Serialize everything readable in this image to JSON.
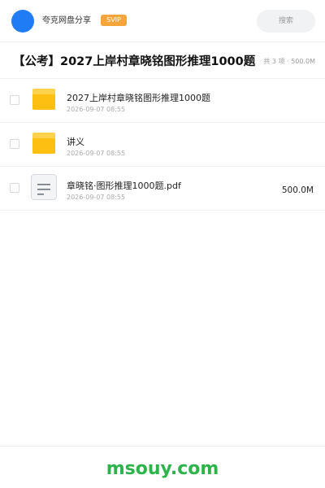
{
  "header": {
    "app_name": "夸克网盘分享",
    "badge": "SVIP",
    "search_placeholder": "搜索",
    "avatar_color": "#1f7cf5",
    "badge_color": "#f6a53a"
  },
  "folder": {
    "title": "【公考】2027上岸村章晓铭图形推理1000题",
    "meta": "共 3 项 · 500.0M"
  },
  "files": [
    {
      "name": "2027上岸村章晓铭图形推理1000题",
      "date": "2026-09-07 08:55",
      "size": "",
      "icon": "folder-icon"
    },
    {
      "name": "讲义",
      "date": "2026-09-07 08:55",
      "size": "",
      "icon": "folder-icon"
    },
    {
      "name": "章晓铭·图形推理1000题.pdf",
      "date": "2026-09-07 08:55",
      "size": "500.0M",
      "icon": "document-icon"
    }
  ],
  "footer": {
    "watermark": "msouy.com",
    "watermark_color": "#2db34a"
  }
}
